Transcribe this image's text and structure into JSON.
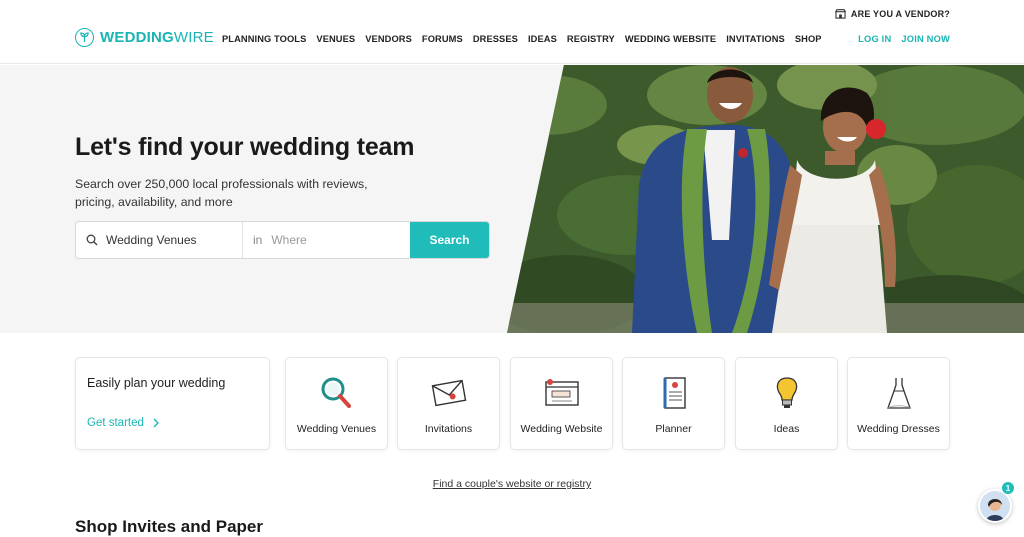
{
  "header": {
    "vendor_link": "ARE YOU A VENDOR?",
    "logo_bold": "WEDDING",
    "logo_light": "WIRE",
    "nav": [
      "PLANNING TOOLS",
      "VENUES",
      "VENDORS",
      "FORUMS",
      "DRESSES",
      "IDEAS",
      "REGISTRY",
      "WEDDING WEBSITE",
      "INVITATIONS",
      "SHOP"
    ],
    "login": "LOG IN",
    "join": "JOIN NOW"
  },
  "hero": {
    "title": "Let's find your wedding team",
    "subtitle": "Search over 250,000 local professionals with reviews, pricing, availability, and more",
    "search_value": "Wedding Venues",
    "location_prefix": "in",
    "location_placeholder": "Where",
    "search_button": "Search"
  },
  "plan_card": {
    "title": "Easily plan your wedding",
    "cta": "Get started"
  },
  "categories": [
    {
      "label": "Wedding Venues",
      "icon": "magnifier-icon"
    },
    {
      "label": "Invitations",
      "icon": "envelope-icon"
    },
    {
      "label": "Wedding Website",
      "icon": "browser-window-icon"
    },
    {
      "label": "Planner",
      "icon": "notebook-icon"
    },
    {
      "label": "Ideas",
      "icon": "lightbulb-icon"
    },
    {
      "label": "Wedding Dresses",
      "icon": "dress-icon"
    }
  ],
  "couple_link": "Find a couple's website or registry",
  "section_title": "Shop Invites and Paper",
  "chat": {
    "badge": "1"
  },
  "colors": {
    "accent": "#19b5b3",
    "button": "#1fbcb9",
    "hero_bg": "#f5f5f5"
  }
}
